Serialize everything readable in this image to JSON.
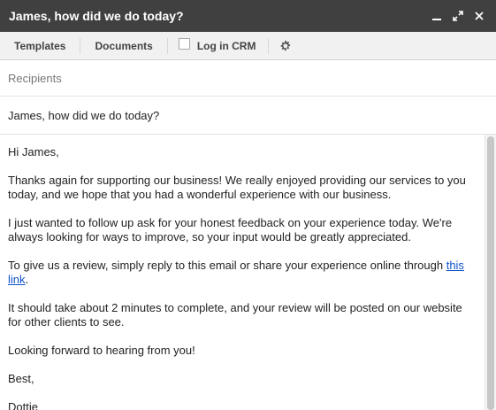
{
  "window": {
    "title": "James, how did we do today?"
  },
  "toolbar": {
    "templates_label": "Templates",
    "documents_label": "Documents",
    "crm_label": "Log in CRM",
    "crm_checked": false
  },
  "recipients": {
    "placeholder": "Recipients"
  },
  "subject": {
    "value": "James, how did we do today?"
  },
  "body": {
    "greeting": "Hi James,",
    "para1": "Thanks again for supporting our business! We really enjoyed providing our services to you today, and we hope that you had a wonderful experience with our business.",
    "para2": "I just wanted to follow up ask for your honest feedback on your experience today. We're always looking for ways to improve, so your input would be greatly appreciated.",
    "para3_text": "To give us a review, simply reply to this email or share your experience online through ",
    "para3_link": "this link",
    "para3_end": ".",
    "para4": "It should take about 2 minutes to complete, and your review will be posted on our website for other clients to see.",
    "para5": "Looking forward to hearing from you!",
    "closing": "Best,",
    "signature": "Dottie"
  },
  "icons": {
    "minimize": "minimize-icon",
    "expand": "expand-icon",
    "close": "close-icon",
    "settings": "gear-icon"
  },
  "colors": {
    "titlebar": "#404040",
    "toolbar": "#f1f1f1",
    "link": "#1155cc"
  }
}
